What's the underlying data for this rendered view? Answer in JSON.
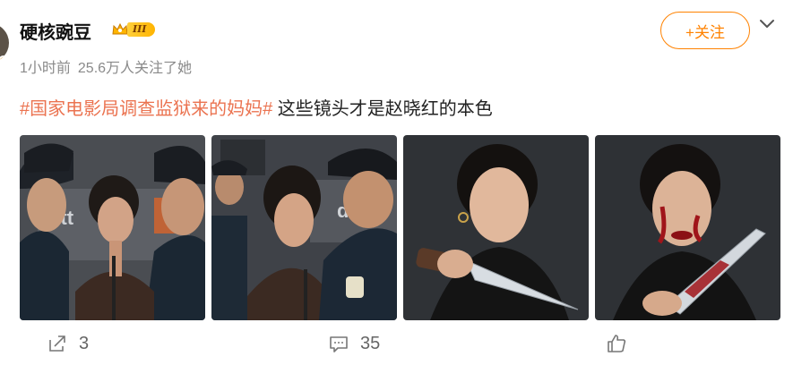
{
  "author": {
    "name": "硬核豌豆",
    "vip_level": "III",
    "time": "1小时前",
    "followers": "25.6万人关注了她"
  },
  "follow_button": {
    "label": "+关注"
  },
  "post": {
    "topic": "#国家电影局调查监狱来的妈妈#",
    "text": " 这些镜头才是赵晓红的本色"
  },
  "images": [
    {
      "desc": "woman-with-police"
    },
    {
      "desc": "woman-shouting-police"
    },
    {
      "desc": "woman-holding-knife"
    },
    {
      "desc": "woman-bloody-knife"
    }
  ],
  "actions": {
    "share_count": "3",
    "comment_count": "35",
    "like_count": ""
  },
  "colors": {
    "accent": "#ff8200",
    "topic": "#eb7350",
    "meta": "#8a8a8a"
  }
}
